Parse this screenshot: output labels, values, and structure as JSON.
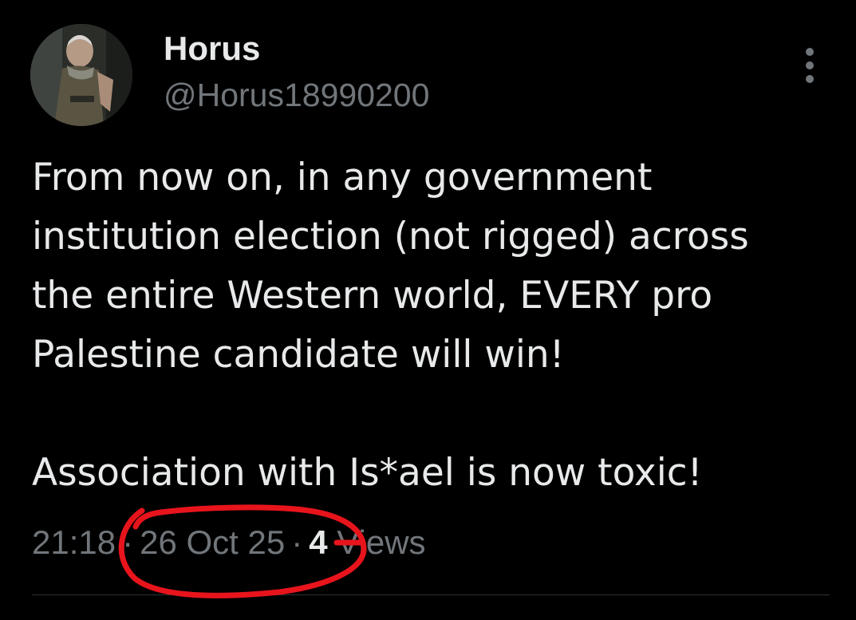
{
  "tweet": {
    "author": {
      "display_name": "Horus",
      "handle": "@Horus18990200",
      "avatar_icon": "avatar-soldier-photo"
    },
    "text_lines_para1": [
      "From now on, in any government",
      "institution election (not rigged) across",
      "the entire Western world, EVERY pro",
      "Palestine candidate will win!"
    ],
    "text_para2": "Association with Is*ael is now toxic!",
    "meta": {
      "time": "21:18",
      "separator": "·",
      "date": "26 Oct 25",
      "views_count": "4",
      "views_label": "Views"
    },
    "more_icon": "more-vertical-icon"
  },
  "colors": {
    "background": "#000000",
    "primary_text": "#e7e9ea",
    "secondary_text": "#71767b",
    "annotation_red": "#e8141c"
  }
}
